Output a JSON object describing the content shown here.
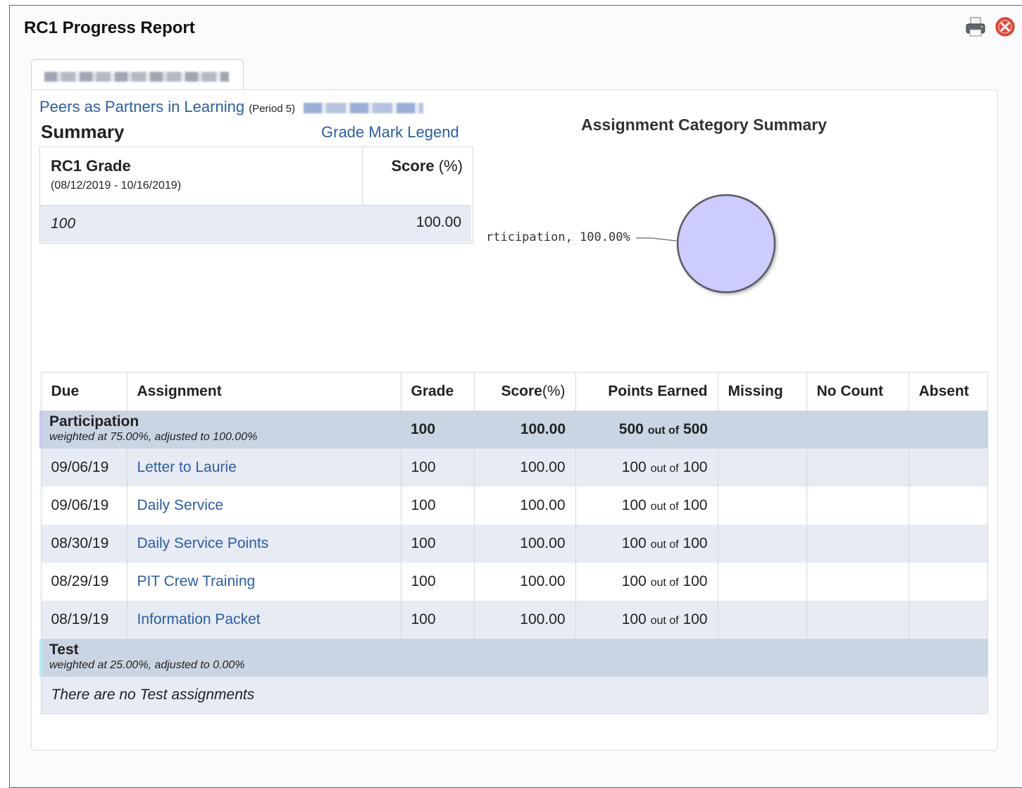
{
  "window": {
    "title": "RC1 Progress Report"
  },
  "icons": {
    "print": "printer-icon",
    "close": "close-icon"
  },
  "course": {
    "name": "Peers as Partners in Learning",
    "period": "(Period 5)"
  },
  "summary": {
    "heading": "Summary",
    "legend_link": "Grade Mark Legend",
    "grade_header": "RC1 Grade",
    "date_range": "(08/12/2019 - 10/16/2019)",
    "score_header": "Score",
    "score_unit": "(%)",
    "grade_value": "100",
    "score_value": "100.00"
  },
  "chart": {
    "title": "Assignment Category Summary",
    "slice_label": "rticipation, 100.00%"
  },
  "chart_data": {
    "type": "pie",
    "title": "Assignment Category Summary",
    "categories": [
      "Participation"
    ],
    "values": [
      100.0
    ],
    "colors": [
      "#ccccff"
    ]
  },
  "table": {
    "headers": {
      "due": "Due",
      "assignment": "Assignment",
      "grade": "Grade",
      "score": "Score",
      "score_unit": "(%)",
      "points": "Points Earned",
      "missing": "Missing",
      "nocount": "No Count",
      "absent": "Absent"
    },
    "out_of": "out of",
    "categories": [
      {
        "name": "Participation",
        "weight_text": "weighted at 75.00%, adjusted to 100.00%",
        "grade": "100",
        "score": "100.00",
        "earned": "500",
        "possible": "500"
      },
      {
        "name": "Test",
        "weight_text": "weighted at 25.00%, adjusted to 0.00%",
        "empty_text": "There are no Test assignments"
      }
    ],
    "rows": [
      {
        "due": "09/06/19",
        "name": "Letter to Laurie",
        "grade": "100",
        "score": "100.00",
        "earned": "100",
        "possible": "100"
      },
      {
        "due": "09/06/19",
        "name": "Daily Service",
        "grade": "100",
        "score": "100.00",
        "earned": "100",
        "possible": "100"
      },
      {
        "due": "08/30/19",
        "name": "Daily Service Points",
        "grade": "100",
        "score": "100.00",
        "earned": "100",
        "possible": "100"
      },
      {
        "due": "08/29/19",
        "name": "PIT Crew Training",
        "grade": "100",
        "score": "100.00",
        "earned": "100",
        "possible": "100"
      },
      {
        "due": "08/19/19",
        "name": "Information Packet",
        "grade": "100",
        "score": "100.00",
        "earned": "100",
        "possible": "100"
      }
    ]
  },
  "colors": {
    "link": "#2a5ea7",
    "category_bg": "#c9d5e3",
    "alt_row_bg": "#e7ebf3",
    "pie_fill": "#ccccff"
  }
}
